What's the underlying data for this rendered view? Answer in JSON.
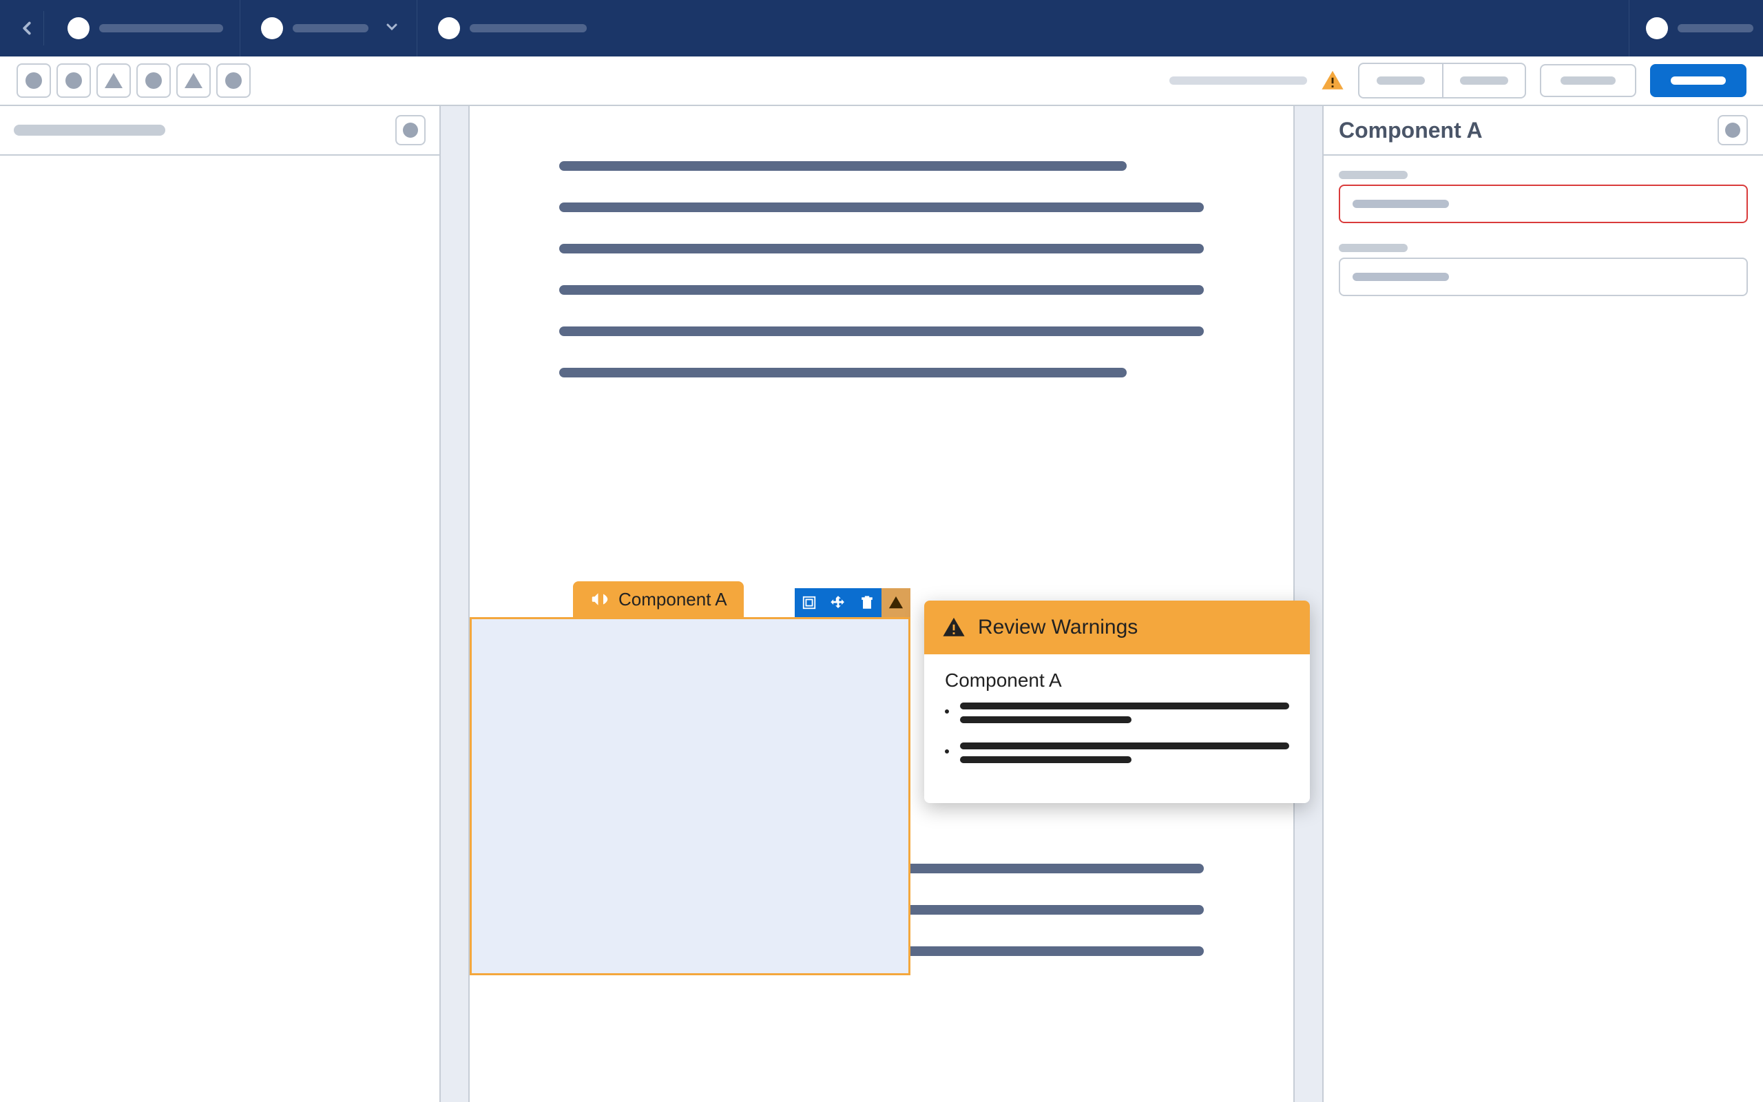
{
  "topnav": {
    "tabs": [
      {
        "width": 180
      },
      {
        "width": 110,
        "hasDropdown": true
      },
      {
        "width": 170
      }
    ],
    "rightTab": {
      "width": 110
    }
  },
  "toolbar": {
    "buttons": [
      "circle",
      "circle",
      "triangle",
      "circle",
      "triangle",
      "circle"
    ],
    "statusWarningColor": "#f4a73d"
  },
  "leftPanel": {},
  "canvas": {
    "component": {
      "tabLabel": "Component A"
    },
    "popover": {
      "title": "Review Warnings",
      "subhead": "Component A",
      "items": [
        {
          "lines": [
            "full",
            "short"
          ]
        },
        {
          "lines": [
            "full",
            "short"
          ]
        }
      ]
    }
  },
  "rightPanel": {
    "title": "Component A",
    "fields": [
      {
        "error": true
      },
      {
        "error": false
      }
    ]
  }
}
